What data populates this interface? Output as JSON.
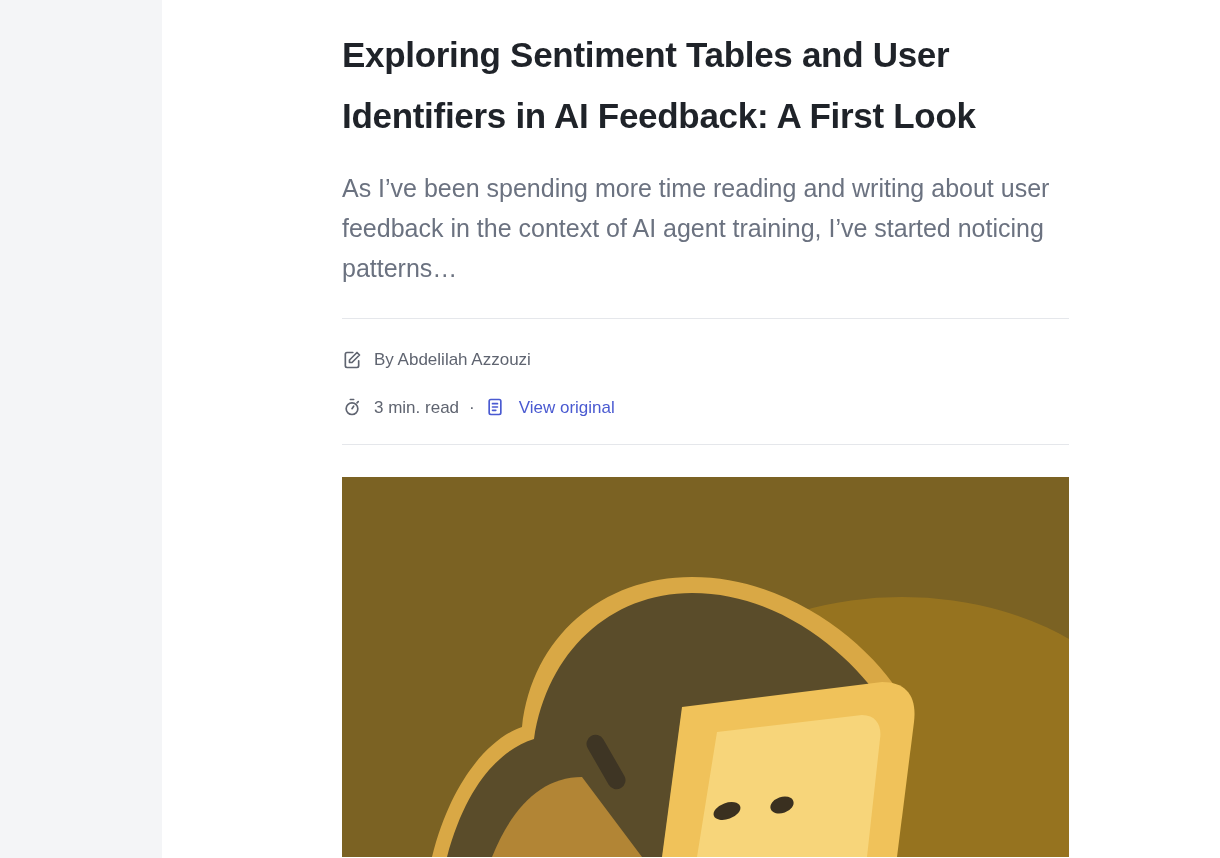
{
  "article": {
    "title": "Exploring Sentiment Tables and User Identifiers in AI Feedback: A First Look",
    "excerpt": "As I’ve been spending more time reading and writing about user feedback in the context of AI agent training, I’ve started noticing patterns…",
    "author": "By Abdelilah Azzouzi",
    "read_time": "3 min. read",
    "separator": "·",
    "link": "View original"
  }
}
